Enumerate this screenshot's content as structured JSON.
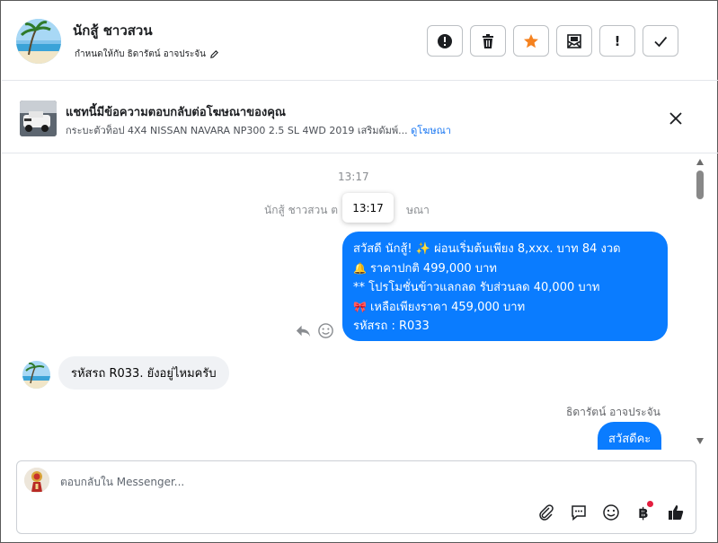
{
  "header": {
    "contact_name": "นักสู้ ชาวสวน",
    "assign_text": "กำหนดให้กับ ธิดารัตน์ อาจประจัน",
    "toolbar": [
      {
        "name": "alert-circle-button",
        "icon": "alert-circle-icon"
      },
      {
        "name": "delete-button",
        "icon": "trash-icon"
      },
      {
        "name": "star-button",
        "icon": "star-icon",
        "color": "#f5821f"
      },
      {
        "name": "mark-unread-button",
        "icon": "envelope-icon"
      },
      {
        "name": "follow-up-button",
        "icon": "exclamation-icon",
        "label": "!"
      },
      {
        "name": "done-button",
        "icon": "check-icon"
      }
    ]
  },
  "ad_banner": {
    "title": "แชทนี้มีข้อความตอบกลับต่อโฆษณาของคุณ",
    "subtitle": "กระบะตัวท็อป 4X4 NISSAN NAVARA NP300 2.5 SL 4WD 2019 เสริมดัมพ์...",
    "link_text": "ดูโฆษณา"
  },
  "chat": {
    "timestamp": "13:17",
    "tooltip_time": "13:17",
    "system_text_left": "นักสู้ ชาวสวน ต",
    "system_text_right": "ษณา",
    "outgoing_message": {
      "lines": [
        {
          "emoji_before": "",
          "text": "สวัสดี นักสู้! ✨  ผ่อนเริ่มต้นเพียง 8,xxx. บาท 84 งวด"
        },
        {
          "emoji_before": "🔔",
          "text": " ราคาปกติ 499,000 บาท"
        },
        {
          "emoji_before": "",
          "text": "** โปรโมชั่นข้าวแลกลด รับส่วนลด 40,000 บาท"
        },
        {
          "emoji_before": "🎀",
          "text": "  เหลือเพียงราคา 459,000 บาท"
        },
        {
          "emoji_before": "",
          "text": " รหัสรถ : R033"
        }
      ]
    },
    "incoming_message": "รหัสรถ R033. ยังอยู่ไหมครับ",
    "sender_name": "ธิดารัตน์ อาจประจัน",
    "outgoing_short": "สวัสดีคะ"
  },
  "composer": {
    "placeholder": "ตอบกลับใน Messenger...",
    "value": "",
    "tools": [
      "paperclip-icon",
      "saved-reply-icon",
      "emoji-icon",
      "baht-icon",
      "thumbs-up-icon"
    ],
    "baht_symbol": "฿"
  },
  "colors": {
    "accent": "#0a7cff",
    "star": "#f5821f",
    "link": "#1876f2",
    "notification_dot": "#e41e3f"
  }
}
